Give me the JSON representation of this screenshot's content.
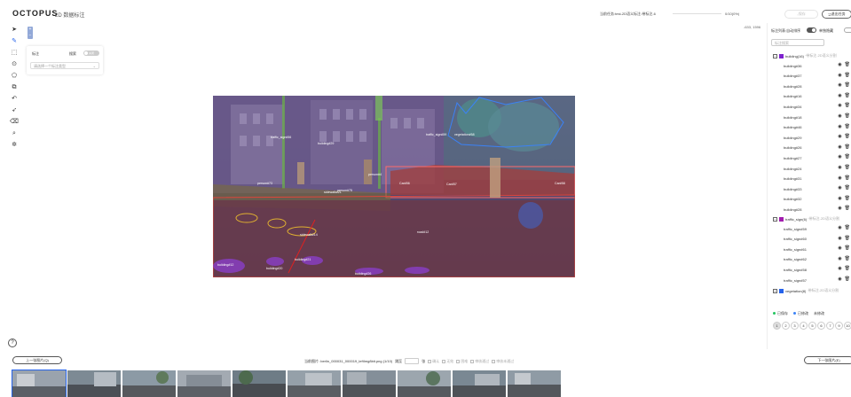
{
  "app": {
    "brand": "OCTOPUS",
    "subtitle": "2D 数据标注"
  },
  "header": {
    "task_info": "当前任务:test-2D语义标注-带标注-6",
    "progress_text": "0/10(0%)",
    "progress_fraction": 0.0,
    "save_label": "保存",
    "exit_label": "退出任务"
  },
  "tools": [
    "pointer-icon",
    "pen-icon",
    "box-select-icon",
    "point-icon",
    "polygon-icon",
    "layers-icon",
    "undo-icon",
    "brush-icon",
    "eraser-icon",
    "zoom-region-icon",
    "magic-icon"
  ],
  "zoom": {
    "plus": "+",
    "minus": "−"
  },
  "label_panel": {
    "title": "标注",
    "search_label": "搜索",
    "search_toggle": "关闭",
    "select_placeholder": "请选择一个标注类型"
  },
  "canvas": {
    "coords": "-633, 1596"
  },
  "right_panel": {
    "sort_label": "标注列表:自动排序",
    "hide_label": "单独隐藏",
    "search_placeholder": "标注搜索",
    "groups": [
      {
        "name": "building(16)",
        "meta": "·带标注-2D语义分割",
        "color": "#7e22ce",
        "items": [
          "building#36",
          "building#37",
          "building#28",
          "building#16",
          "building#34",
          "building#18",
          "building#46",
          "building#29",
          "building#26",
          "building#27",
          "building#24",
          "building#31",
          "building#33",
          "building#32",
          "building#28"
        ]
      },
      {
        "name": "traffic_sign(6)",
        "meta": "·带标注-2D语义分割",
        "color": "#a21caf",
        "items": [
          "traffic_sign#59",
          "traffic_sign#60",
          "traffic_sign#61",
          "traffic_sign#62",
          "traffic_sign#58",
          "traffic_sign#57"
        ]
      },
      {
        "name": "vegetation(8)",
        "meta": "·带标注-2D语义分割",
        "color": "#2563eb",
        "items": []
      }
    ],
    "legend": [
      {
        "label": "已保存",
        "color": "#22c55e"
      },
      {
        "label": "已修改",
        "color": "#3b82f6"
      },
      {
        "label": "未修改",
        "color": "#999999"
      }
    ],
    "pages": [
      "1",
      "2",
      "3",
      "4",
      "5",
      "6",
      "7",
      "9",
      "10"
    ],
    "active_page": "1"
  },
  "canvas_labels": [
    "traffic_sign#56",
    "building#29",
    "vegetation#58",
    "traffic_sign#59",
    "person#4",
    "Car#57",
    "Car#58",
    "sidewalk#14",
    "road#12",
    "building#12",
    "building#20",
    "building#21",
    "building#26",
    "sidewalk#21",
    "person#73",
    "person#75",
    "Car#56"
  ],
  "bottom": {
    "prev_label": "上一张图片(Q)",
    "next_label": "下一张图片(E)",
    "image_info": "当前图片: berlin_000031_000019_leftImg8bit.png (1/10)",
    "jump_label": "跳至",
    "page_suffix": "张",
    "checks": [
      "确认",
      "无效",
      "困难",
      "审核通过",
      "审核未通过"
    ]
  }
}
